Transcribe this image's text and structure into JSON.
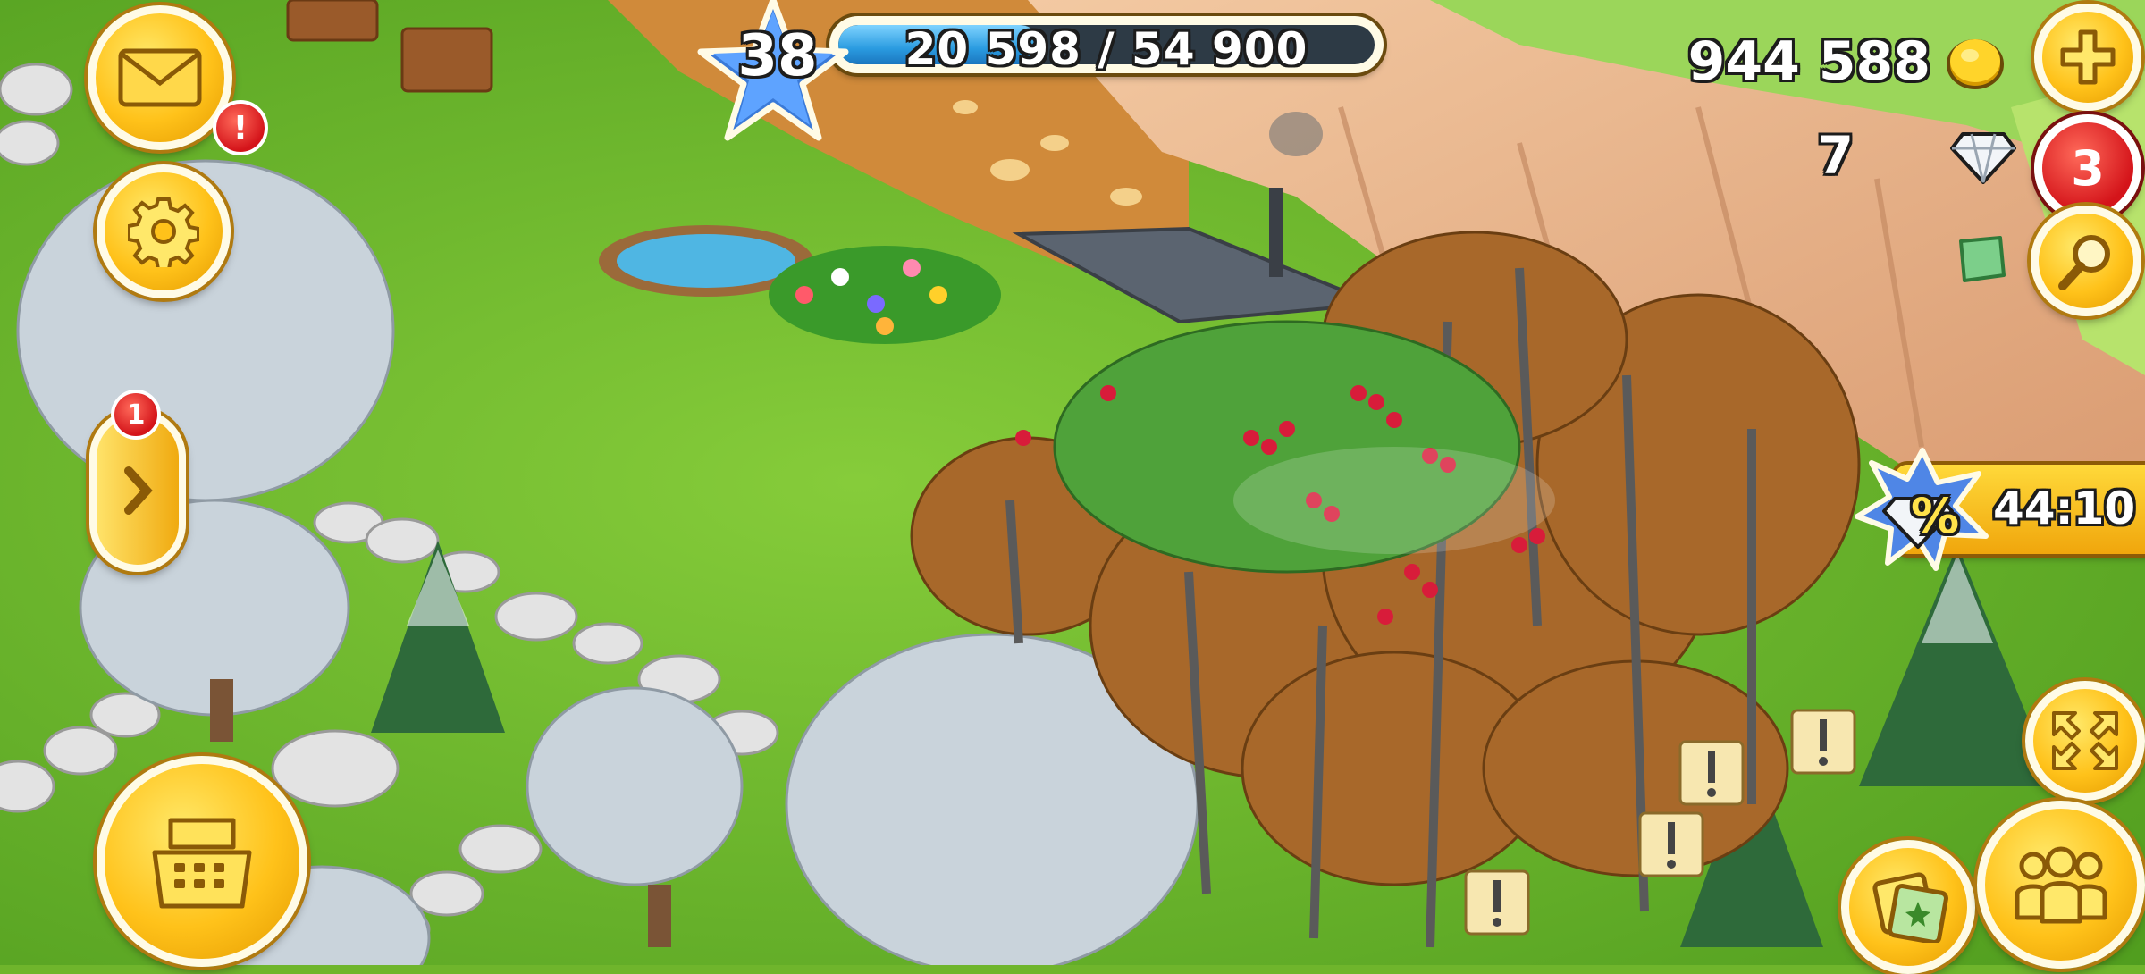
{
  "hud": {
    "level": "38",
    "xp_text": "20 598 / 54 900",
    "xp_progress": 0.375,
    "coins": "944 588",
    "diamonds": "7",
    "diamond_offer_badge": "3",
    "mail_badge": "!",
    "side_badge": "1",
    "sale_timer": "44:10",
    "sale_symbol": "%"
  },
  "icons": {
    "mail": "mail-icon",
    "settings": "gear-icon",
    "expand": "chevron-right-icon",
    "shop": "cash-register-icon",
    "add_coins": "plus-icon",
    "search": "magnifier-icon",
    "fullscreen": "expand-arrows-icon",
    "friends": "friends-icon",
    "tiles": "tile-cards-icon"
  },
  "colors": {
    "grass": "#6fb52c",
    "accent_yellow": "#ffc21a",
    "badge_red": "#d4141a",
    "xp_blue": "#2a9be0"
  }
}
